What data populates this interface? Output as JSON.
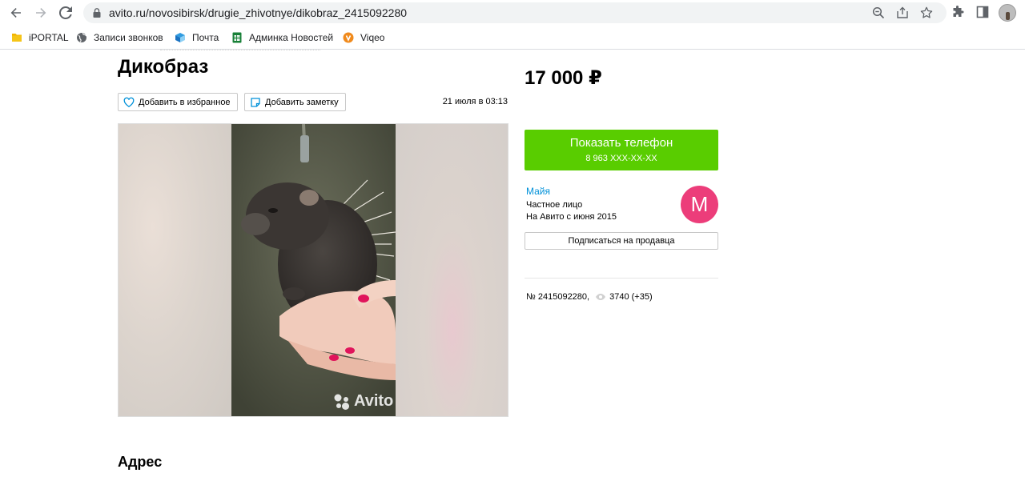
{
  "browser": {
    "url": "avito.ru/novosibirsk/drugie_zhivotnye/dikobraz_2415092280",
    "bookmarks": [
      {
        "label": "iPORTAL",
        "icon": "folder-icon"
      },
      {
        "label": "Записи звонков",
        "icon": "globe-icon"
      },
      {
        "label": "Почта",
        "icon": "mail-cube-icon"
      },
      {
        "label": "Админка Новостей",
        "icon": "sheets-icon"
      },
      {
        "label": "Viqeo",
        "icon": "viqeo-icon"
      }
    ]
  },
  "listing": {
    "title": "Дикобраз",
    "favorite_label": "Добавить в избранное",
    "note_label": "Добавить заметку",
    "date": "21 июля в 03:13",
    "price": "17 000 ₽",
    "watermark": "Avito"
  },
  "contact": {
    "button_label": "Показать телефон",
    "phone_masked": "8 963 XXX-XX-XX"
  },
  "seller": {
    "name": "Майя",
    "type": "Частное лицо",
    "since": "На Авито с июня 2015",
    "avatar_letter": "М",
    "subscribe_label": "Подписаться на продавца",
    "avatar_color": "#ec3d7a"
  },
  "stats": {
    "item_number": "№ 2415092280,",
    "views": "3740 (+35)"
  },
  "sections": {
    "address_title": "Адрес"
  },
  "colors": {
    "accent_green": "#59cd00",
    "link_blue": "#0091d9"
  }
}
